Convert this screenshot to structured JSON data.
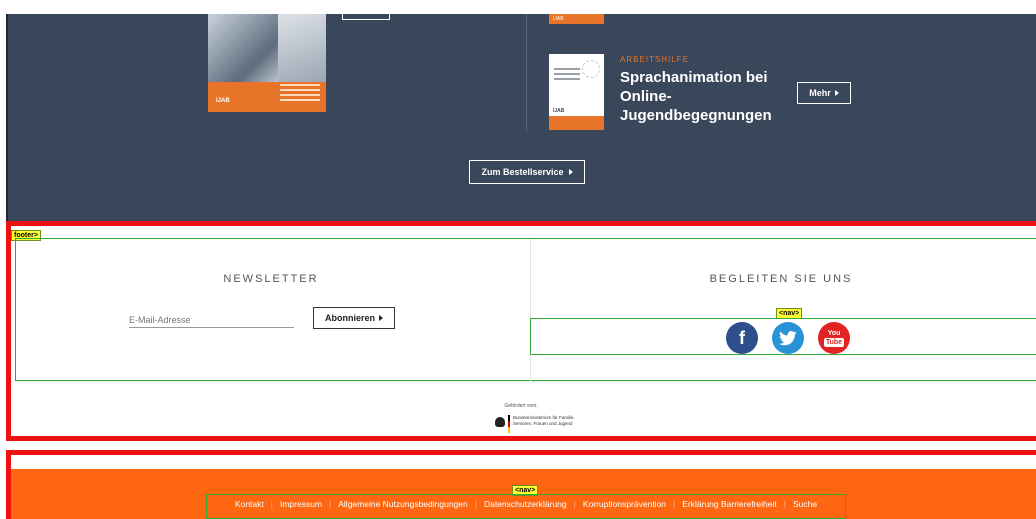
{
  "publications": {
    "right_item": {
      "kicker": "ARBEITSHILFE",
      "title": "Sprachanimation bei Online-Jugendbegegnungen",
      "more_label": "Mehr"
    },
    "left_cover_brand": "IJAB",
    "order_service_label": "Zum Bestellservice"
  },
  "debug_tags": {
    "footer": "footer>",
    "social_nav": "<nav>",
    "bottom_nav": "<nav>"
  },
  "newsletter": {
    "title": "NEWSLETTER",
    "email_placeholder": "E-Mail-Adresse",
    "subscribe_label": "Abonnieren"
  },
  "social": {
    "title": "BEGLEITEN SIE UNS",
    "items": [
      {
        "name": "facebook-icon",
        "glyph": "f"
      },
      {
        "name": "twitter-icon",
        "glyph": "🐦"
      },
      {
        "name": "youtube-icon",
        "glyph_top": "You",
        "glyph_bottom": "Tube"
      }
    ]
  },
  "funding": {
    "label": "Gefördert vom:",
    "ministry": "Bundesministerium für Familie, Senioren, Frauen und Jugend"
  },
  "footer_nav": {
    "links": [
      "Kontakt",
      "Impressum",
      "Allgemeine Nutzungsbedingungen",
      "Datenschutzerklärung",
      "Korruptionsprävention",
      "Erklärung Barrierefreiheit",
      "Suche"
    ]
  },
  "colors": {
    "dark_section": "#3a4659",
    "accent_orange": "#ff6611",
    "debug_red": "#ee1111",
    "debug_green": "#33aa33",
    "facebook": "#2f4f8c",
    "twitter": "#2a93d8",
    "youtube": "#e32323"
  }
}
